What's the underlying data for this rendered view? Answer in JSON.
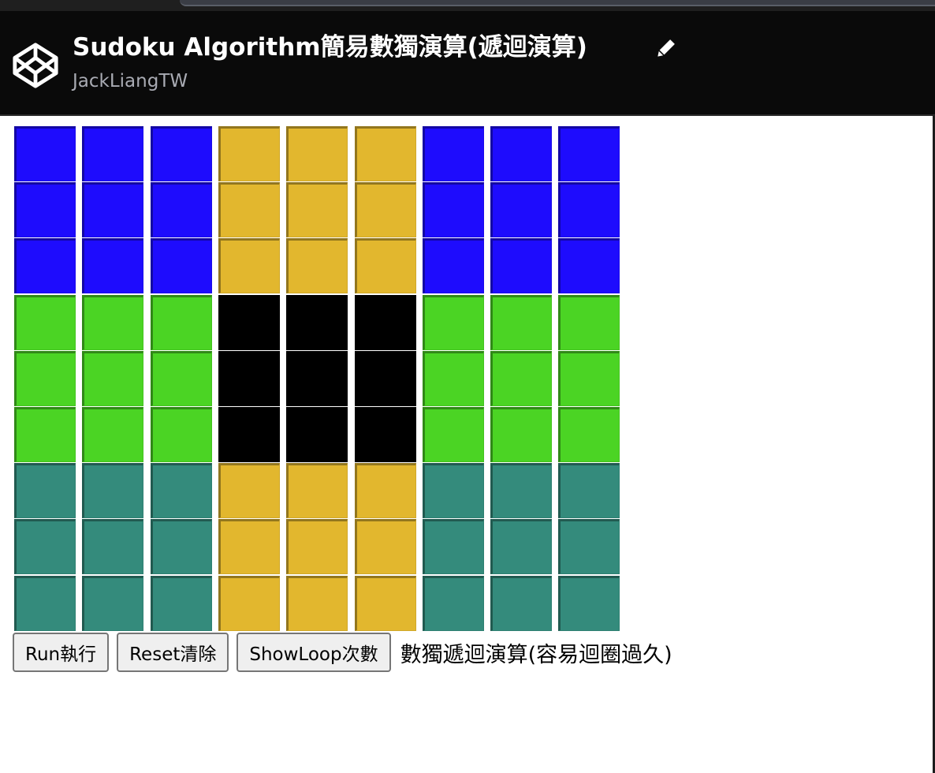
{
  "header": {
    "title": "Sudoku Algorithm簡易數獨演算(遞迴演算)",
    "author": "JackLiangTW",
    "logo_icon": "codepen-logo-icon",
    "edit_icon": "pencil-icon"
  },
  "board": {
    "rows": 9,
    "cols": 9,
    "colors": {
      "blue": "#1e0cfd",
      "gold": "#e2b72e",
      "green": "#4bd424",
      "black": "#000000",
      "teal": "#348b7c"
    },
    "box_colors": [
      [
        "blue",
        "gold",
        "blue"
      ],
      [
        "green",
        "black",
        "green"
      ],
      [
        "teal",
        "gold",
        "teal"
      ]
    ]
  },
  "controls": {
    "run_label": "Run執行",
    "reset_label": "Reset清除",
    "showloop_label": "ShowLoop次數",
    "status_text": "數獨遞迴演算(容易迴圈過久)"
  }
}
